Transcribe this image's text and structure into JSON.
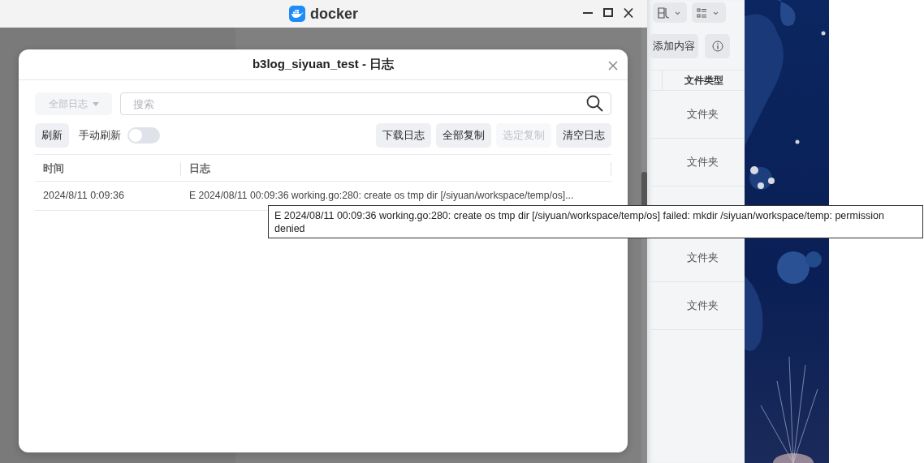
{
  "window": {
    "title": "docker"
  },
  "dialog": {
    "title": "b3log_siyuan_test - 日志",
    "filter": {
      "label": "全部日志",
      "disabled": true
    },
    "search": {
      "placeholder": "搜索"
    },
    "refresh_button": "刷新",
    "auto_refresh": {
      "label": "手动刷新",
      "on": false
    },
    "actions": [
      {
        "label": "下载日志",
        "disabled": false
      },
      {
        "label": "全部复制",
        "disabled": false
      },
      {
        "label": "选定复制",
        "disabled": true
      },
      {
        "label": "清空日志",
        "disabled": false
      }
    ],
    "table": {
      "columns": [
        "时间",
        "日志"
      ],
      "rows": [
        {
          "time": "2024/8/11 0:09:36",
          "log": "E 2024/08/11 00:09:36 working.go:280: create os tmp dir [/siyuan/workspace/temp/os]..."
        }
      ]
    },
    "tooltip": "E 2024/08/11 00:09:36 working.go:280: create os tmp dir [/siyuan/workspace/temp/os] failed: mkdir /siyuan/workspace/temp: permission denied"
  },
  "file_panel": {
    "add_button": "添加内容",
    "columns": [
      "文件类型"
    ],
    "rows": [
      {
        "kind": "file",
        "type": "文件夹"
      },
      {
        "kind": "file",
        "type": "文件夹"
      },
      {
        "kind": "blank"
      },
      {
        "kind": "file",
        "type": "文件夹"
      },
      {
        "kind": "file",
        "type": "文件夹"
      }
    ]
  }
}
